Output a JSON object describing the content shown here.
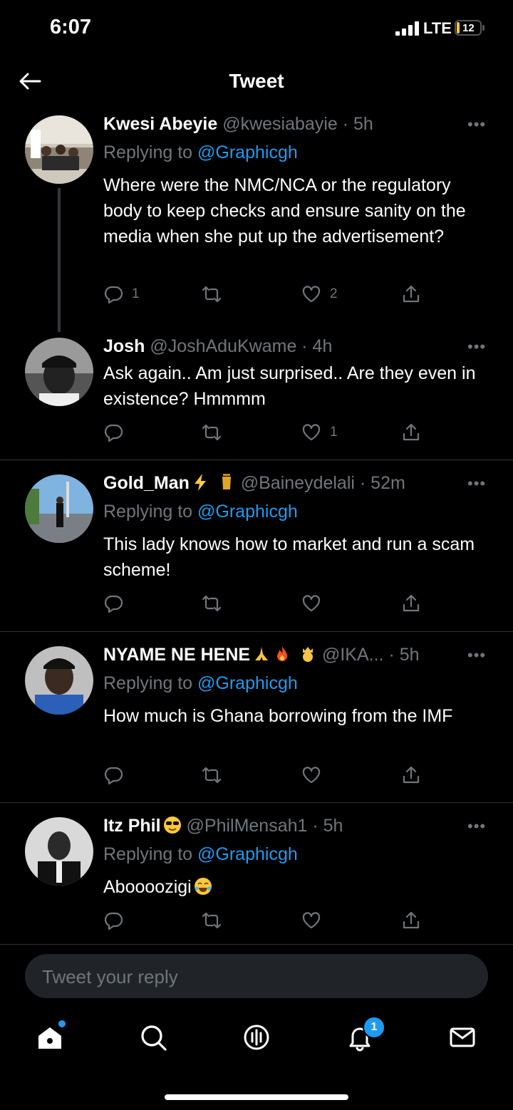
{
  "status_bar": {
    "time": "6:07",
    "network": "LTE",
    "battery": "12"
  },
  "header": {
    "title": "Tweet"
  },
  "tweets": [
    {
      "name": "Kwesi Abeyie",
      "handle": "@kwesiabayie · 5h",
      "replying_prefix": "Replying to ",
      "replying_to": "@Graphicgh",
      "text": "Where were the NMC/NCA or the regulatory body to keep checks and ensure sanity on the media when she put up the advertisement?",
      "replies": "1",
      "retweets": "",
      "likes": "2"
    },
    {
      "name": "Josh",
      "handle": "@JoshAduKwame · 4h",
      "text": "Ask again.. Am just surprised.. Are they even in existence? Hmmmm",
      "replies": "",
      "retweets": "",
      "likes": "1"
    },
    {
      "name": "Gold_Man",
      "handle": "@Baineydelali · 52m",
      "replying_prefix": "Replying to ",
      "replying_to": "@Graphicgh",
      "text": "This lady knows how to market and run a scam scheme!",
      "replies": "",
      "retweets": "",
      "likes": ""
    },
    {
      "name": "NYAME NE HENE",
      "handle": "@IKA... · 5h",
      "replying_prefix": "Replying to ",
      "replying_to": "@Graphicgh",
      "text": "How much is Ghana borrowing from the IMF",
      "replies": "",
      "retweets": "",
      "likes": ""
    },
    {
      "name": "Itz Phil",
      "handle": "@PhilMensah1 · 5h",
      "replying_prefix": "Replying to ",
      "replying_to": "@Graphicgh",
      "text": "Aboooozigi",
      "replies": "",
      "retweets": "",
      "likes": ""
    }
  ],
  "composer": {
    "placeholder": "Tweet your reply"
  },
  "tabbar": {
    "notifications_badge": "1"
  },
  "colors": {
    "accent": "#1d9bf0",
    "muted": "#71767b",
    "background": "#000000"
  }
}
